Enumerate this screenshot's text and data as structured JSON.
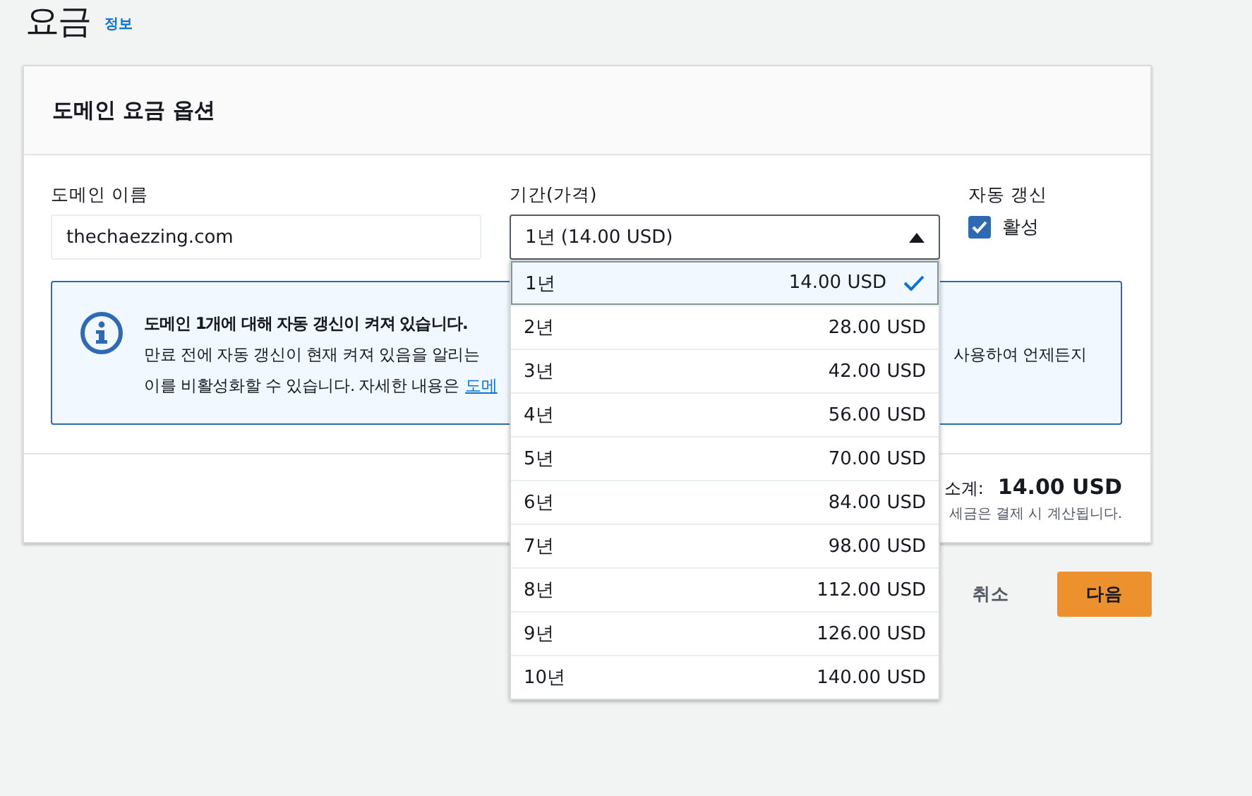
{
  "page": {
    "title": "요금",
    "info_link": "정보"
  },
  "card": {
    "title": "도메인 요금 옵션",
    "domain_name": {
      "label": "도메인 이름",
      "value": "thechaezzing.com"
    },
    "duration": {
      "label": "기간(가격)",
      "value": "1년 (14.00 USD)",
      "expanded": true,
      "options": [
        {
          "years": "1년",
          "price": "14.00 USD",
          "selected": true
        },
        {
          "years": "2년",
          "price": "28.00 USD",
          "selected": false
        },
        {
          "years": "3년",
          "price": "42.00 USD",
          "selected": false
        },
        {
          "years": "4년",
          "price": "56.00 USD",
          "selected": false
        },
        {
          "years": "5년",
          "price": "70.00 USD",
          "selected": false
        },
        {
          "years": "6년",
          "price": "84.00 USD",
          "selected": false
        },
        {
          "years": "7년",
          "price": "98.00 USD",
          "selected": false
        },
        {
          "years": "8년",
          "price": "112.00 USD",
          "selected": false
        },
        {
          "years": "9년",
          "price": "126.00 USD",
          "selected": false
        },
        {
          "years": "10년",
          "price": "140.00 USD",
          "selected": false
        }
      ]
    },
    "auto_renew": {
      "label": "자동 갱신",
      "option": "활성",
      "checked": true
    },
    "alert": {
      "title": "도메인 1개에 대해 자동 갱신이 켜져 있습니다.",
      "line_1_left": "만료 전에 자동 갱신이 현재 켜져 있음을 알리는 ",
      "line_1_right": "사용하여 언제든지",
      "line_2": "이를 비활성화할 수 있습니다. 자세한 내용은 ",
      "line_2_link": "도메"
    },
    "subtotal": {
      "label": "소계:",
      "value": "14.00 USD",
      "note": "세금은 결제 시 계산됩니다."
    }
  },
  "buttons": {
    "cancel": "취소",
    "next": "다음"
  }
}
